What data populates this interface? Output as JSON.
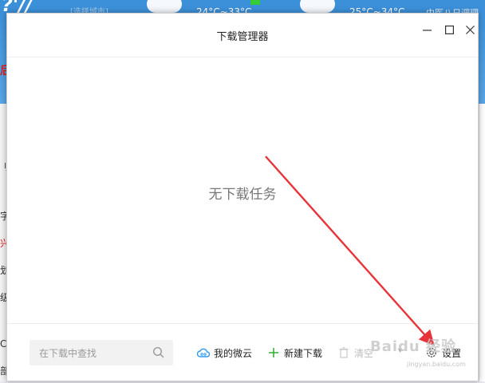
{
  "background": {
    "logo_text": "?'//",
    "city_select": "[选择城市]",
    "temp_1": "24°C~33°C",
    "temp_2": "25°C~34°C",
    "right_text": "中医八日调理",
    "red_char": "后",
    "fragments": [
      "刂",
      "字",
      "兴",
      "划",
      "级",
      "C加",
      "部"
    ]
  },
  "dialog": {
    "title": "下载管理器",
    "empty_message": "无下载任务",
    "search_placeholder": "在下载中查找",
    "actions": {
      "weiyun": "我的微云",
      "new_download": "新建下载",
      "clear": "清空",
      "settings": "设置"
    }
  },
  "watermark": {
    "text": "Baidu 经验",
    "url": "jingyan.baidu.com"
  },
  "colors": {
    "accent_blue": "#2e9bf0",
    "new_green": "#3bb33b",
    "arrow_red": "#e8333a"
  }
}
